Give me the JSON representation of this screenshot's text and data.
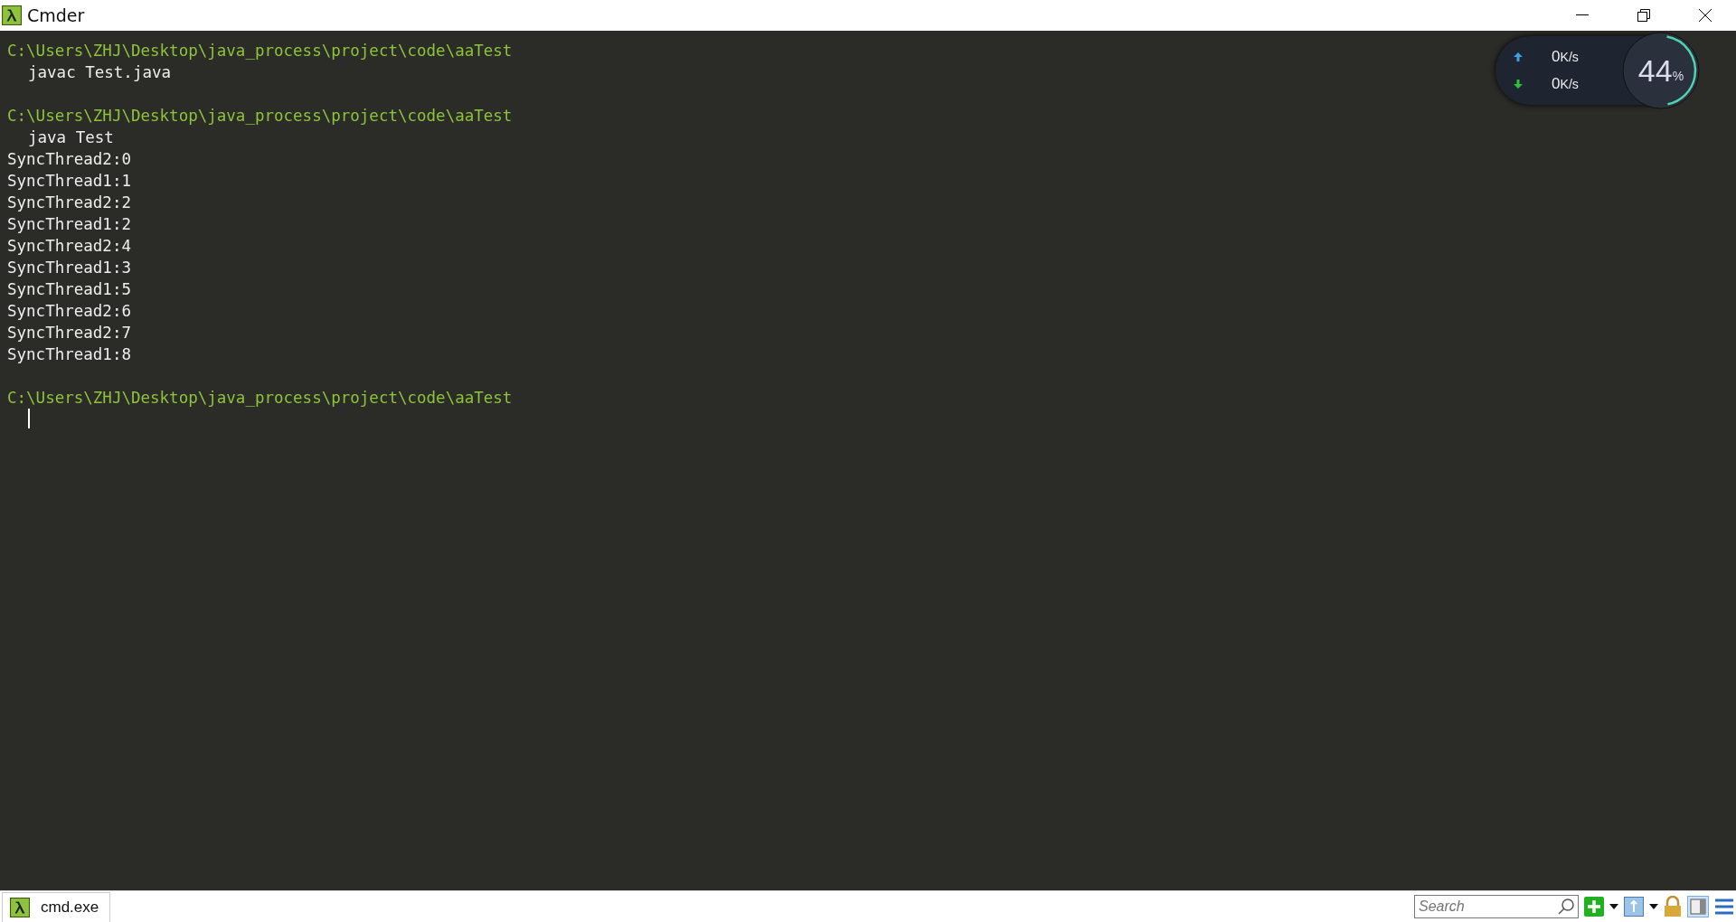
{
  "window": {
    "title": "Cmder"
  },
  "console": {
    "lines": [
      {
        "kind": "path",
        "text": "C:\\Users\\ZHJ\\Desktop\\java_process\\project\\code\\aaTest"
      },
      {
        "kind": "command",
        "text": "javac Test.java"
      },
      {
        "kind": "blank"
      },
      {
        "kind": "path",
        "text": "C:\\Users\\ZHJ\\Desktop\\java_process\\project\\code\\aaTest"
      },
      {
        "kind": "command",
        "text": "java Test"
      },
      {
        "kind": "output",
        "text": "SyncThread2:0"
      },
      {
        "kind": "output",
        "text": "SyncThread1:1"
      },
      {
        "kind": "output",
        "text": "SyncThread2:2"
      },
      {
        "kind": "output",
        "text": "SyncThread1:2"
      },
      {
        "kind": "output",
        "text": "SyncThread2:4"
      },
      {
        "kind": "output",
        "text": "SyncThread1:3"
      },
      {
        "kind": "output",
        "text": "SyncThread1:5"
      },
      {
        "kind": "output",
        "text": "SyncThread2:6"
      },
      {
        "kind": "output",
        "text": "SyncThread2:7"
      },
      {
        "kind": "output",
        "text": "SyncThread1:8"
      },
      {
        "kind": "blank"
      },
      {
        "kind": "path",
        "text": "C:\\Users\\ZHJ\\Desktop\\java_process\\project\\code\\aaTest"
      },
      {
        "kind": "cursor"
      }
    ]
  },
  "speed_widget": {
    "upload": {
      "value": "0",
      "unit": "K/s"
    },
    "download": {
      "value": "0",
      "unit": "K/s"
    },
    "usage": {
      "value": "44",
      "unit": "%",
      "level": 0.44
    }
  },
  "status_bar": {
    "tab": {
      "label": "cmd.exe",
      "selected": true
    },
    "search": {
      "placeholder": "Search"
    }
  }
}
